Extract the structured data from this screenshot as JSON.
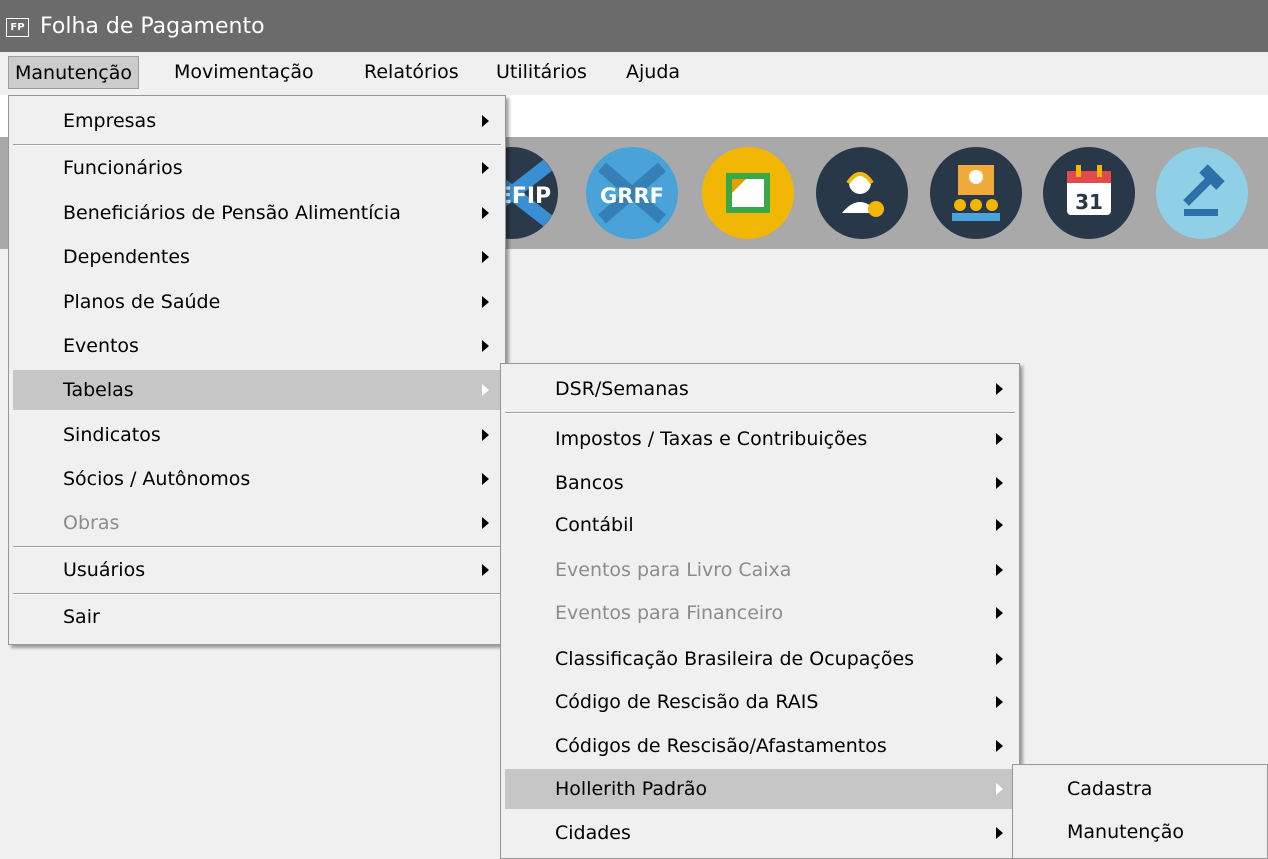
{
  "window": {
    "title": "Folha de Pagamento",
    "logo_text": "FP"
  },
  "menubar": [
    "Manutenção",
    "Movimentação",
    "Relatórios",
    "Utilitários",
    "Ajuda"
  ],
  "toolbar": {
    "icons": [
      {
        "name": "sefip-icon",
        "text": "EFIP"
      },
      {
        "name": "grrf-icon",
        "text": "GRRF"
      },
      {
        "name": "document-folder-icon"
      },
      {
        "name": "support-agent-icon"
      },
      {
        "name": "meeting-people-icon"
      },
      {
        "name": "calendar-icon",
        "text": "31"
      },
      {
        "name": "gavel-icon"
      }
    ]
  },
  "menu_manutencao": {
    "items": [
      {
        "label": "Empresas"
      },
      {
        "label": "Funcionários"
      },
      {
        "label": "Beneficiários de Pensão Alimentícia"
      },
      {
        "label": "Dependentes"
      },
      {
        "label": "Planos de Saúde"
      },
      {
        "label": "Eventos"
      },
      {
        "label": "Tabelas"
      },
      {
        "label": "Sindicatos"
      },
      {
        "label": "Sócios / Autônomos"
      },
      {
        "label": "Obras"
      },
      {
        "label": "Usuários"
      },
      {
        "label": "Sair"
      }
    ]
  },
  "menu_tabelas": {
    "items": [
      {
        "label": "DSR/Semanas"
      },
      {
        "label": "Impostos / Taxas e Contribuições"
      },
      {
        "label": "Bancos"
      },
      {
        "label": "Contábil"
      },
      {
        "label": "Eventos para Livro Caixa"
      },
      {
        "label": "Eventos para Financeiro"
      },
      {
        "label": "Classificação Brasileira de Ocupações"
      },
      {
        "label": "Código de Rescisão da RAIS"
      },
      {
        "label": "Códigos de Rescisão/Afastamentos"
      },
      {
        "label": "Hollerith Padrão"
      },
      {
        "label": "Cidades"
      }
    ]
  },
  "menu_hollerith": {
    "items": [
      {
        "label": "Cadastra"
      },
      {
        "label": "Manutenção"
      }
    ]
  }
}
